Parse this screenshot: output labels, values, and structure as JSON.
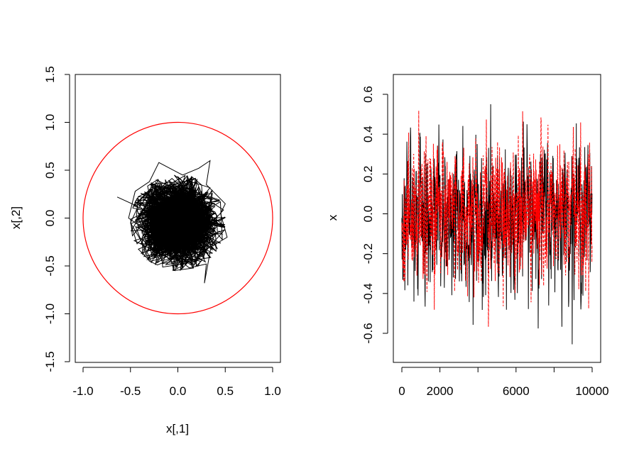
{
  "chart_data": [
    {
      "type": "line",
      "panel": "left",
      "xlabel": "x[,1]",
      "ylabel": "x[,2]",
      "xlim": [
        -1.0,
        1.0
      ],
      "ylim": [
        -1.5,
        1.5
      ],
      "x_ticks": [
        -1.0,
        -0.5,
        0.0,
        0.5,
        1.0
      ],
      "x_tick_labels": [
        "-1.0",
        "-0.5",
        "0.0",
        "0.5",
        "1.0"
      ],
      "y_ticks": [
        -1.5,
        -1.0,
        -0.5,
        0.0,
        0.5,
        1.0,
        1.5
      ],
      "y_tick_labels": [
        "-1.5",
        "-1.0",
        "-0.5",
        "0.0",
        "0.5",
        "1.0",
        "1.5"
      ],
      "circle": {
        "center": [
          0,
          0
        ],
        "radius": 1.0,
        "color": "#ff0000"
      },
      "trajectory": {
        "color": "#000000",
        "center": [
          0.0,
          -0.05
        ],
        "typical_spread": 0.2,
        "points": [
          [
            -0.64,
            0.22
          ],
          [
            -0.42,
            0.12
          ],
          [
            -0.5,
            -0.05
          ],
          [
            -0.35,
            -0.3
          ],
          [
            -0.28,
            -0.45
          ],
          [
            -0.05,
            -0.38
          ],
          [
            0.12,
            -0.52
          ],
          [
            0.3,
            -0.48
          ],
          [
            0.28,
            -0.68
          ],
          [
            0.35,
            -0.3
          ],
          [
            0.52,
            -0.2
          ],
          [
            0.45,
            0.05
          ],
          [
            0.5,
            0.15
          ],
          [
            0.3,
            0.35
          ],
          [
            0.34,
            0.6
          ],
          [
            0.22,
            0.52
          ],
          [
            0.05,
            0.45
          ],
          [
            -0.2,
            0.58
          ],
          [
            -0.3,
            0.38
          ],
          [
            -0.45,
            0.28
          ],
          [
            -0.52,
            0.0
          ],
          [
            -0.3,
            -0.15
          ],
          [
            0.0,
            -0.05
          ],
          [
            0.2,
            0.1
          ],
          [
            0.35,
            0.0
          ]
        ]
      }
    },
    {
      "type": "line",
      "panel": "right",
      "xlabel": "",
      "ylabel": "x",
      "xlim": [
        0,
        10000
      ],
      "ylim": [
        -0.7,
        0.65
      ],
      "x_ticks": [
        0,
        2000,
        4000,
        6000,
        8000,
        10000
      ],
      "x_tick_labels": [
        "0",
        "2000",
        "",
        "6000",
        "",
        "10000"
      ],
      "y_ticks": [
        -0.6,
        -0.4,
        -0.2,
        0.0,
        0.2,
        0.4,
        0.6
      ],
      "y_tick_labels": [
        "-0.6",
        "-0.4",
        "-0.2",
        "0.0",
        "0.2",
        "0.4",
        "0.6"
      ],
      "series": [
        {
          "color": "#000000",
          "line_style": "solid",
          "n": 10000,
          "approx_min": -0.66,
          "approx_max": 0.55,
          "typical_sd": 0.2
        },
        {
          "color": "#ff0000",
          "line_style": "dashed",
          "n": 10000,
          "approx_min": -0.68,
          "approx_max": 0.64,
          "typical_sd": 0.2
        }
      ]
    }
  ]
}
